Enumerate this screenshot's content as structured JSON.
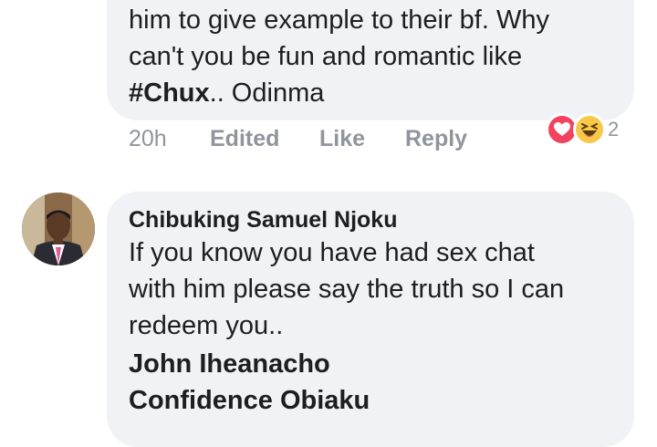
{
  "comment1": {
    "lines": [
      "him to give example to their bf. Why",
      "can't you be fun and romantic like"
    ],
    "hashtag": "#Chux",
    "tail": ".. Odinma",
    "meta": {
      "time": "20h",
      "edited": "Edited",
      "like": "Like",
      "reply": "Reply"
    },
    "reactions": {
      "types": [
        "love-icon",
        "haha-icon"
      ],
      "count": "2"
    }
  },
  "comment2": {
    "author": "Chibuking Samuel Njoku",
    "lines": [
      "If you know you have had sex chat",
      "with him please say the truth so I can",
      "redeem you.."
    ],
    "tags": [
      "John Iheanacho",
      "Confidence Obiaku"
    ]
  },
  "colors": {
    "bubble": "#f0f2f5",
    "text": "#1c1e21",
    "meta": "#90949c",
    "love": "#f3425f",
    "haha": "#f7c94b"
  }
}
